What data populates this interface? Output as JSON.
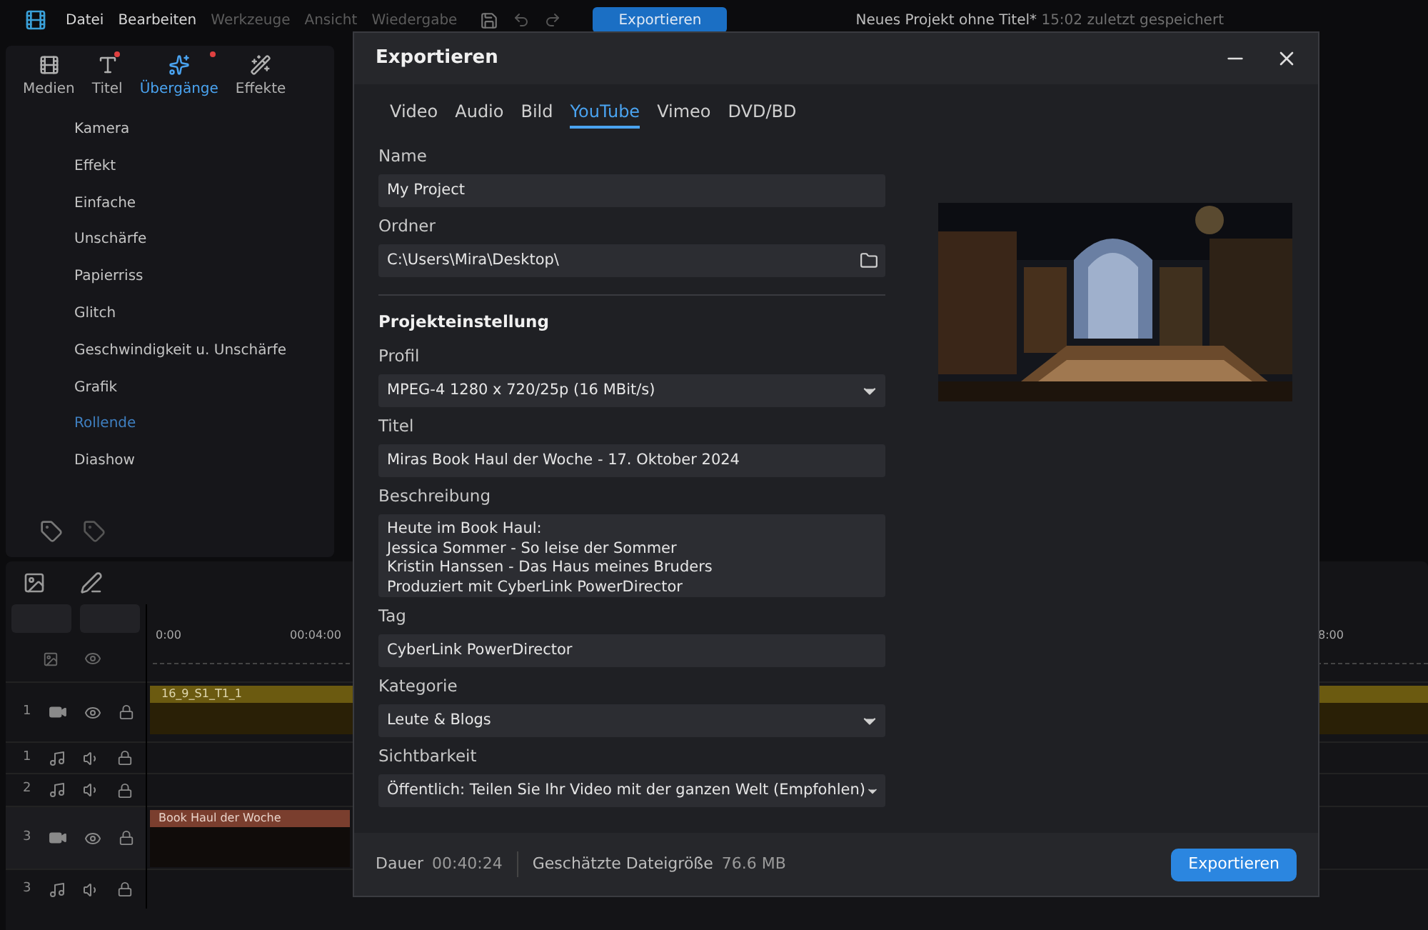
{
  "menu_bar": {
    "items": [
      {
        "label": "Datei",
        "disabled": false
      },
      {
        "label": "Bearbeiten",
        "disabled": false
      },
      {
        "label": "Werkzeuge",
        "disabled": true
      },
      {
        "label": "Ansicht",
        "disabled": true
      },
      {
        "label": "Wiedergabe",
        "disabled": true
      }
    ],
    "export_button": "Exportieren",
    "project_title": "Neues Projekt ohne Titel*",
    "saved_note": "15:02 zuletzt gespeichert"
  },
  "library_tabs": [
    {
      "label": "Medien",
      "selected": false,
      "badge": false
    },
    {
      "label": "Titel",
      "selected": false,
      "badge": true
    },
    {
      "label": "Übergänge",
      "selected": true,
      "badge": true
    },
    {
      "label": "Effekte",
      "selected": false,
      "badge": false
    }
  ],
  "categories": [
    {
      "label": "Kamera",
      "selected": false
    },
    {
      "label": "Effekt",
      "selected": false
    },
    {
      "label": "Einfache",
      "selected": false
    },
    {
      "label": "Unschärfe",
      "selected": false
    },
    {
      "label": "Papierriss",
      "selected": false
    },
    {
      "label": "Glitch",
      "selected": false
    },
    {
      "label": "Geschwindigkeit u. Unschärfe",
      "selected": false
    },
    {
      "label": "Grafik",
      "selected": false
    },
    {
      "label": "Rollende",
      "selected": true
    },
    {
      "label": "Diashow",
      "selected": false
    }
  ],
  "timeline": {
    "ruler": [
      "0:00",
      "00:04:00",
      "8:00"
    ],
    "tracks": [
      {
        "number": "1",
        "kind": "video",
        "clip": "16_9_S1_T1_1"
      },
      {
        "number": "1",
        "kind": "audio"
      },
      {
        "number": "2",
        "kind": "audio"
      },
      {
        "number": "3",
        "kind": "title",
        "clip": "Book Haul der Woche"
      },
      {
        "number": "3",
        "kind": "audio"
      }
    ]
  },
  "dialog": {
    "title": "Exportieren",
    "tabs": [
      {
        "label": "Video",
        "selected": false
      },
      {
        "label": "Audio",
        "selected": false
      },
      {
        "label": "Bild",
        "selected": false
      },
      {
        "label": "YouTube",
        "selected": true
      },
      {
        "label": "Vimeo",
        "selected": false
      },
      {
        "label": "DVD/BD",
        "selected": false
      }
    ],
    "fields_top": [
      {
        "label": "Name",
        "value": "My Project",
        "kind": "text"
      },
      {
        "label": "Ordner",
        "value": "C:\\Users\\Mira\\Desktop\\",
        "kind": "folder"
      }
    ],
    "section": "Projekteinstellung",
    "fields": [
      {
        "label": "Profil",
        "value": "MPEG-4 1280 x 720/25p (16 MBit/s)",
        "kind": "select"
      },
      {
        "label": "Titel",
        "value": "Miras Book Haul der Woche - 17. Oktober 2024",
        "kind": "text"
      },
      {
        "label": "Beschreibung",
        "lines": [
          "Heute im Book Haul:",
          "Jessica Sommer - So leise der Sommer",
          "Kristin Hanssen - Das Haus meines Bruders",
          "Produziert mit CyberLink PowerDirector"
        ],
        "kind": "textarea"
      },
      {
        "label": "Tag",
        "value": "CyberLink PowerDirector",
        "kind": "text"
      },
      {
        "label": "Kategorie",
        "value": "Leute & Blogs",
        "kind": "select"
      },
      {
        "label": "Sichtbarkeit",
        "value": "Öffentlich: Teilen Sie Ihr Video mit der ganzen Welt (Empfohlen)",
        "kind": "select"
      }
    ],
    "footer": {
      "duration_label": "Dauer",
      "duration": "00:40:24",
      "size_label": "Geschätzte Dateigröße",
      "size": "76.6 MB",
      "button": "Exportieren"
    }
  }
}
